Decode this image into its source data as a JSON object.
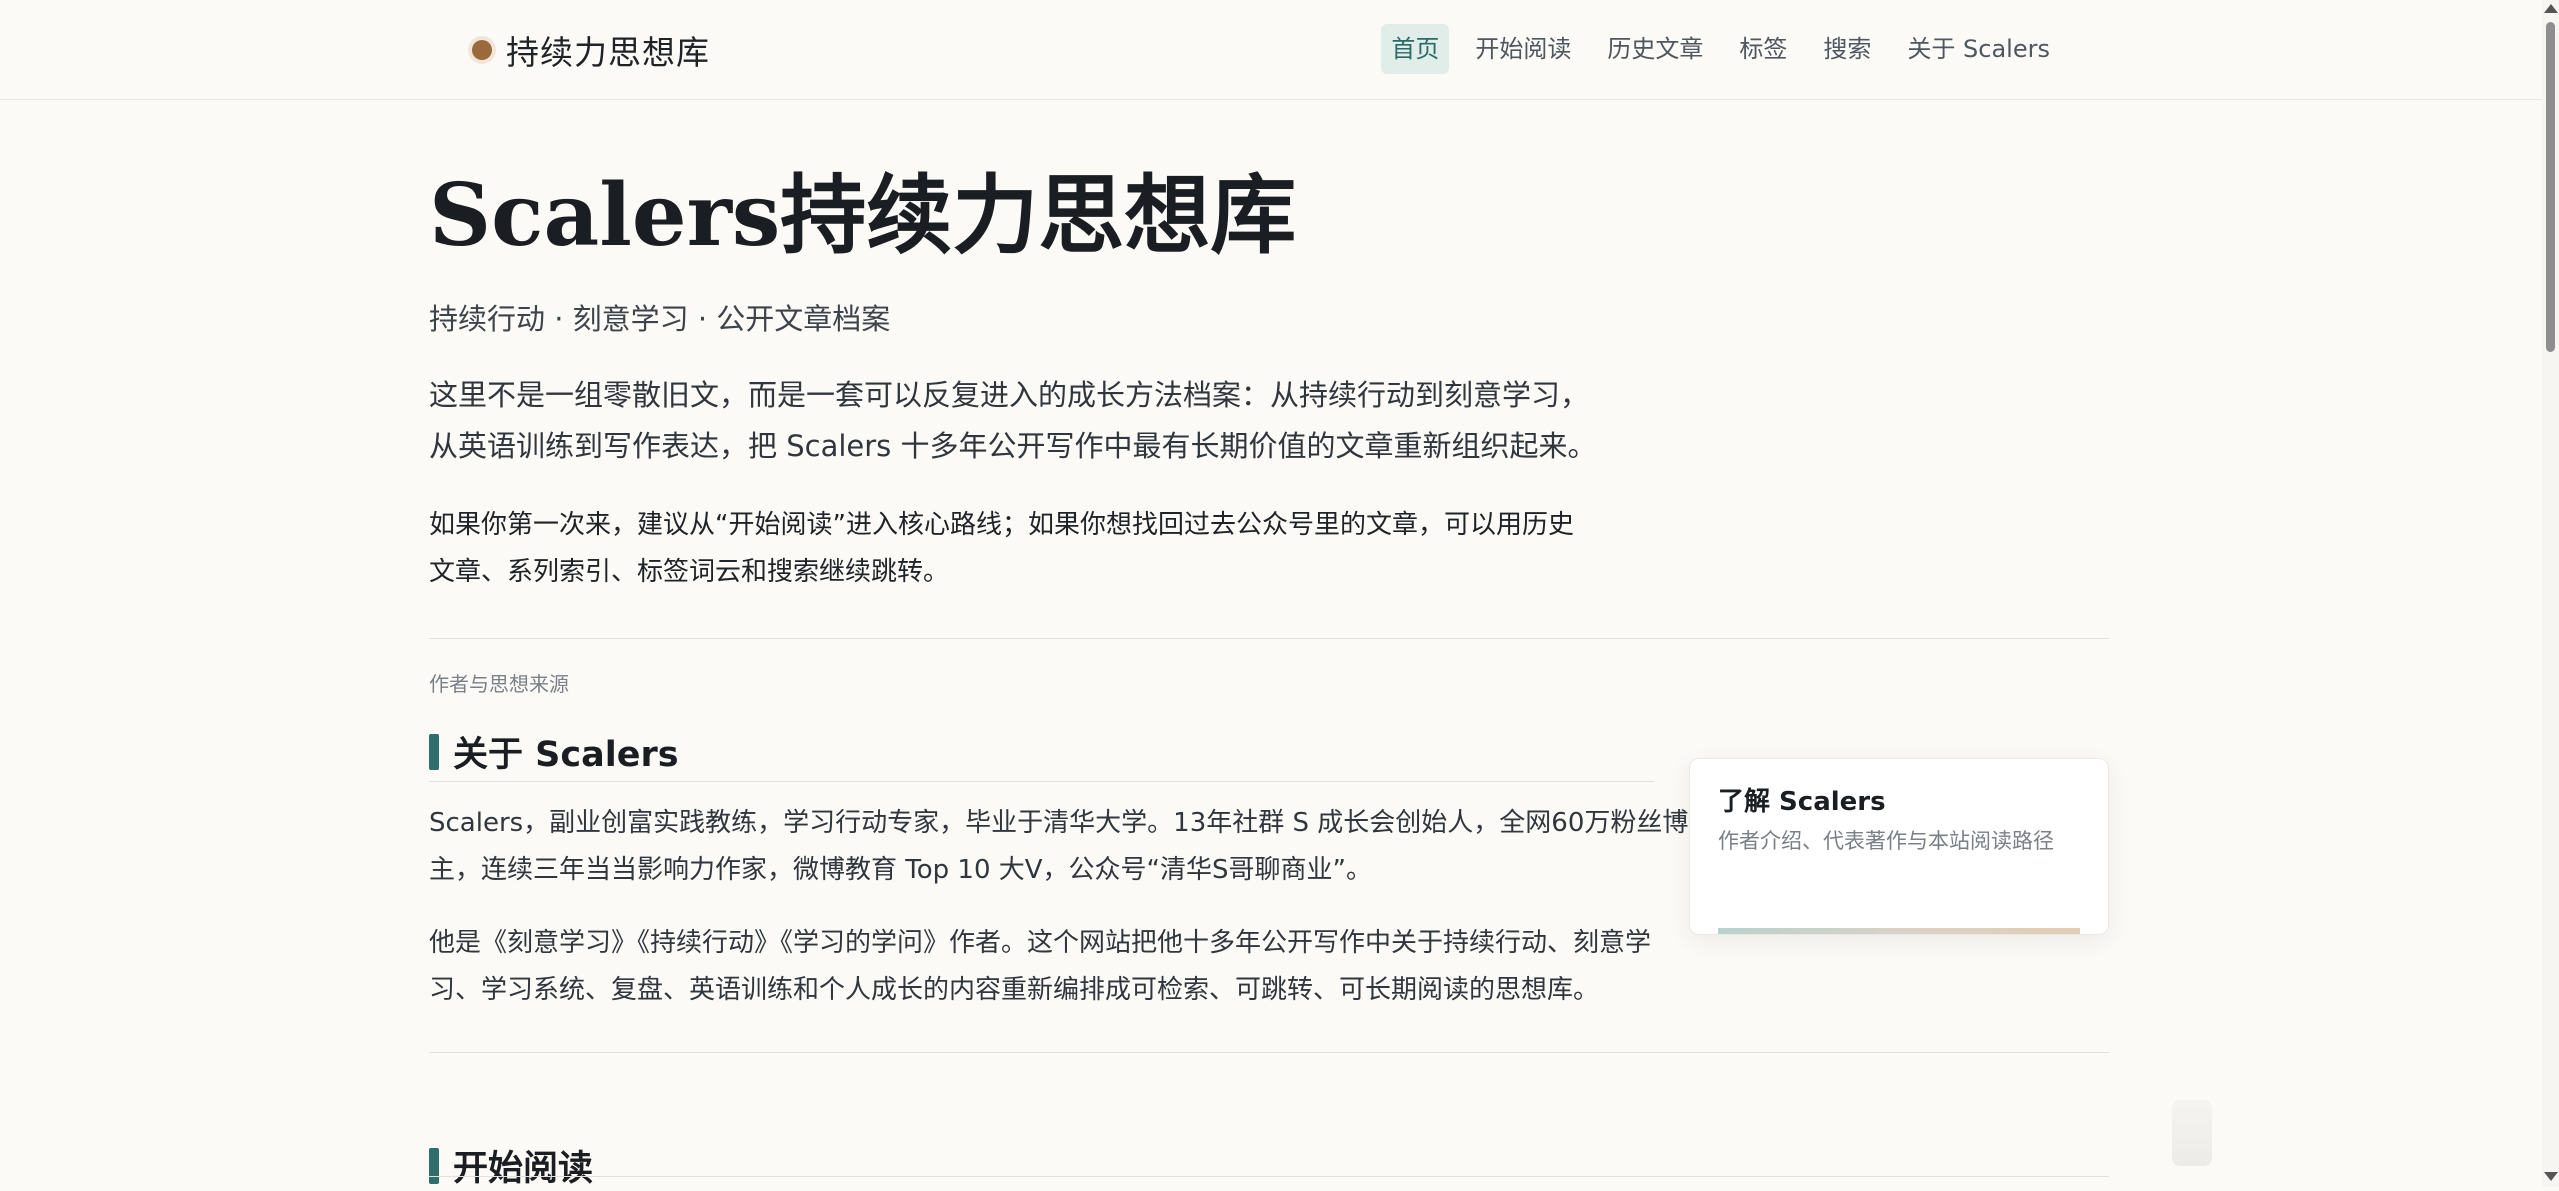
{
  "header": {
    "brand": "持续力思想库",
    "nav": [
      {
        "label": "首页",
        "active": true
      },
      {
        "label": "开始阅读",
        "active": false
      },
      {
        "label": "历史文章",
        "active": false
      },
      {
        "label": "标签",
        "active": false
      },
      {
        "label": "搜索",
        "active": false
      },
      {
        "label": "关于 Scalers",
        "active": false
      }
    ]
  },
  "hero": {
    "title": "Scalers持续力思想库",
    "subtitle": "持续行动 · 刻意学习 · 公开文章档案",
    "lead": [
      "这里不是一组零散旧文，而是一套可以反复进入的成长方法档案：从持续行动到刻意学习，",
      "从英语训练到写作表达，把 Scalers 十多年公开写作中最有长期价值的文章重新组织起来。"
    ],
    "note": [
      "如果你第一次来，建议从“开始阅读”进入核心路线；如果你想找回过去公众号里的文章，可以用历史",
      "文章、系列索引、标签词云和搜索继续跳转。"
    ]
  },
  "about": {
    "kicker": "作者与思想来源",
    "title": "关于 Scalers",
    "paragraphs": [
      [
        "Scalers，副业创富实践教练，学习行动专家，毕业于清华大学。13年社群 S 成长会创始人，全网60万粉丝博",
        "主，连续三年当当影响力作家，微博教育 Top 10 大V，公众号“清华S哥聊商业”。"
      ],
      [
        "他是《刻意学习》《持续行动》《学习的学问》作者。这个网站把他十多年公开写作中关于持续行动、刻意学",
        "习、学习系统、复盘、英语训练和个人成长的内容重新编排成可检索、可跳转、可长期阅读的思想库。"
      ]
    ],
    "card": {
      "title": "了解 Scalers",
      "desc": "作者介绍、代表著作与本站阅读路径"
    }
  },
  "next_section": {
    "title": "开始阅读"
  },
  "colors": {
    "accent": "#2f6e6a",
    "brand_dot": "#9b6a3a",
    "active_nav_bg": "#e0ede9",
    "background": "#fbfaf7"
  }
}
